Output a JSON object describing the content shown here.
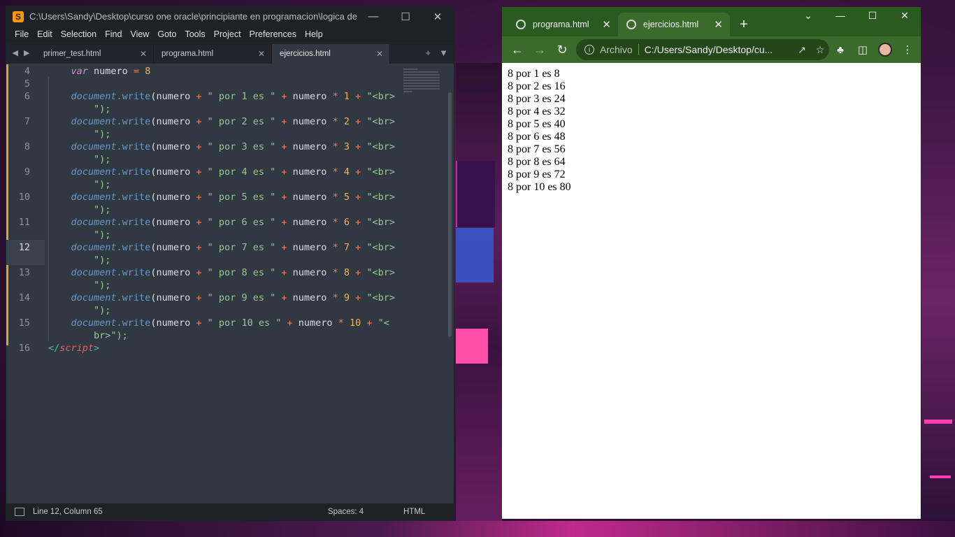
{
  "sublime": {
    "title": "C:\\Users\\Sandy\\Desktop\\curso one oracle\\principiante en programacion\\logica de prog...",
    "menu": [
      "File",
      "Edit",
      "Selection",
      "Find",
      "View",
      "Goto",
      "Tools",
      "Project",
      "Preferences",
      "Help"
    ],
    "tabs": [
      {
        "label": "primer_test.html",
        "active": false
      },
      {
        "label": "programa.html",
        "active": false
      },
      {
        "label": "ejercicios.html",
        "active": true
      }
    ],
    "line_numbers": {
      "l4": "4",
      "l5": "5",
      "l6": "6",
      "l7": "7",
      "l8": "8",
      "l9": "9",
      "l10": "10",
      "l11": "11",
      "l12": "12",
      "l13": "13",
      "l14": "14",
      "l15": "15",
      "l16": "16"
    },
    "code": {
      "var_kw": "var",
      "var_name": " numero ",
      "assign": "=",
      "var_value": " 8",
      "obj": "document",
      "method": ".write",
      "open_paren": "(",
      "ident": "numero",
      "plus": "+",
      "times": "*",
      "close": "\");",
      "multipliers": [
        {
          "str": "\" por 1 es \"",
          "n": "1",
          "br": "\"<br>"
        },
        {
          "str": "\" por 2 es \"",
          "n": "2",
          "br": "\"<br>"
        },
        {
          "str": "\" por 3 es \"",
          "n": "3",
          "br": "\"<br>"
        },
        {
          "str": "\" por 4 es \"",
          "n": "4",
          "br": "\"<br>"
        },
        {
          "str": "\" por 5 es \"",
          "n": "5",
          "br": "\"<br>"
        },
        {
          "str": "\" por 6 es \"",
          "n": "6",
          "br": "\"<br>"
        },
        {
          "str": "\" por 7 es \"",
          "n": "7",
          "br": "\"<br>"
        },
        {
          "str": "\" por 8 es \"",
          "n": "8",
          "br": "\"<br>"
        },
        {
          "str": "\" por 9 es \"",
          "n": "9",
          "br": "\"<br>"
        },
        {
          "str": "\" por 10 es \"",
          "n": "10",
          "br": "\"<"
        }
      ],
      "last_close": "br>\");",
      "script_open": "</",
      "script_name": "script",
      "script_close": ">"
    },
    "status": {
      "position": "Line 12, Column 65",
      "spaces": "Spaces: 4",
      "syntax": "HTML"
    }
  },
  "chrome": {
    "tabs": [
      {
        "label": "programa.html",
        "active": false
      },
      {
        "label": "ejercicios.html",
        "active": true
      }
    ],
    "scheme": "Archivo",
    "url": "C:/Users/Sandy/Desktop/cu...",
    "output": [
      "8 por 1 es 8",
      "8 por 2 es 16",
      "8 por 3 es 24",
      "8 por 4 es 32",
      "8 por 5 es 40",
      "8 por 6 es 48",
      "8 por 7 es 56",
      "8 por 8 es 64",
      "8 por 9 es 72",
      "8 por 10 es 80"
    ]
  },
  "colors": {
    "sublime_bg": "#303841",
    "chrome_frame": "#2a5a1f",
    "chrome_toolbar": "#3a6b2c"
  }
}
